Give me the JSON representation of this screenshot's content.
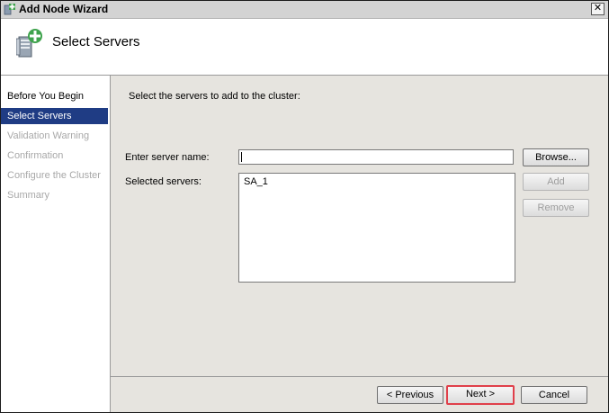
{
  "window": {
    "title": "Add Node Wizard",
    "close_glyph": "✕"
  },
  "header": {
    "title": "Select Servers"
  },
  "sidebar": {
    "items": [
      {
        "label": "Before You Begin",
        "state": "done"
      },
      {
        "label": "Select Servers",
        "state": "active"
      },
      {
        "label": "Validation Warning",
        "state": "pending"
      },
      {
        "label": "Confirmation",
        "state": "pending"
      },
      {
        "label": "Configure the Cluster",
        "state": "pending"
      },
      {
        "label": "Summary",
        "state": "pending"
      }
    ]
  },
  "main": {
    "instruction": "Select the servers to add to the cluster:",
    "server_name_label": "Enter server name:",
    "server_name_value": "",
    "selected_label": "Selected servers:",
    "selected_servers": [
      "SA_1"
    ],
    "browse_label": "Browse...",
    "add_label": "Add",
    "remove_label": "Remove"
  },
  "footer": {
    "previous_label": "< Previous",
    "next_label": "Next >",
    "cancel_label": "Cancel"
  },
  "colors": {
    "active_step_bg": "#1f3c84",
    "highlight_border": "#e0404a",
    "content_bg": "#e6e4df"
  }
}
